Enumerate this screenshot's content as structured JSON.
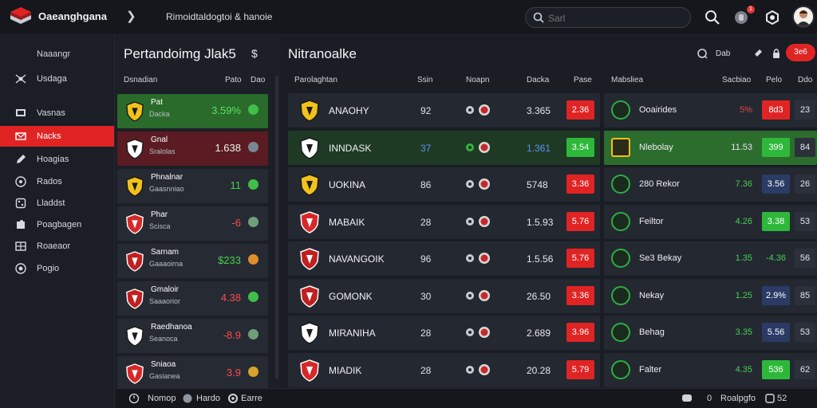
{
  "header": {
    "brand": "Oaeanghgana",
    "crumb": "Rimoidtaldogtoi & hanoie",
    "search_placeholder": "Sarl",
    "notification_count": "1",
    "icons": [
      "chevron-right-icon",
      "search-icon",
      "bell-icon",
      "settings-icon"
    ]
  },
  "sidenav": {
    "header": "Naaangr",
    "items": [
      {
        "label": "Usdaga",
        "icon": "network-icon"
      },
      {
        "label": "Vasnas",
        "icon": "flag-icon"
      },
      {
        "label": "Nacks",
        "icon": "mail-icon",
        "active": true
      },
      {
        "label": "Hoagias",
        "icon": "pen-icon"
      },
      {
        "label": "Rados",
        "icon": "target-icon"
      },
      {
        "label": "Lladdst",
        "icon": "dice-icon"
      },
      {
        "label": "Poagbagen",
        "icon": "puzzle-icon"
      },
      {
        "label": "Roaeaor",
        "icon": "table-icon"
      },
      {
        "label": "Pogio",
        "icon": "globe-icon"
      }
    ]
  },
  "midpanel": {
    "title": "Pertandoimg Jlak5",
    "dollar": "$",
    "headers": [
      "Dsnadian",
      "Pato",
      "Dao"
    ],
    "cards": [
      {
        "line1": "Pat",
        "line2": "Dacka",
        "value": "3.59%",
        "style": "green",
        "value_color": "#58e35f",
        "dot": "#3fbf4a"
      },
      {
        "line1": "Gnal",
        "line2": "Sralolas",
        "value": "1.638",
        "style": "red",
        "value_color": "#f0f0f0",
        "dot": "#7c8796"
      },
      {
        "line1": "Phnalnar",
        "line2": "Gaasnniao",
        "value": "11",
        "style": "plain",
        "value_color": "#44d14f",
        "dot": "#3fbf4a"
      },
      {
        "line1": "Phar",
        "line2": "Scisca",
        "value": "-6",
        "style": "plain",
        "value_color": "#ff4a4a",
        "dot": "#6f9e7a"
      },
      {
        "line1": "Sarnam",
        "line2": "Gaaaoirna",
        "value": "$233",
        "style": "plain",
        "value_color": "#44d14f",
        "dot": "#e08e2a"
      },
      {
        "line1": "Gmaloir",
        "line2": "Saaaorior",
        "value": "4.38",
        "style": "plain",
        "value_color": "#ff4a4a",
        "dot": "#3fbf4a"
      },
      {
        "line1": "Raedhanoa",
        "line2": "Seanoca",
        "value": "-8.9",
        "style": "plain",
        "value_color": "#ff4a4a",
        "dot": "#6f9e7a"
      },
      {
        "line1": "Sniaoa",
        "line2": "Gasianea",
        "value": "3.9",
        "style": "plain",
        "value_color": "#ff4a4a",
        "dot": "#d8a32a"
      }
    ]
  },
  "main": {
    "title": "Nitranoalke",
    "action_label": "Dab",
    "pill": "3e6",
    "left_headers": [
      "Parolaghtan",
      "Ssin",
      "Noapn",
      "Dacka",
      "Pase"
    ],
    "right_headers": [
      "Mabsliea",
      "Sacbiao",
      "Pelo",
      "Ddo"
    ],
    "rows": [
      {
        "team": "ANAOHY",
        "score": "92",
        "odds": "3.365",
        "btn": "2.36",
        "btn_color": "#e02424",
        "sel": false,
        "r_name": "Ooairides",
        "r_val": "5%",
        "r_val_color": "#e14646",
        "r_btn": "8d3",
        "r_btn_color": "#e02424",
        "r_last": "23"
      },
      {
        "team": "INNDASK",
        "score": "37",
        "odds": "1.361",
        "btn": "3.54",
        "btn_color": "#2eb83a",
        "sel": true,
        "score_color": "#5b8ef5",
        "odds_color": "#5b8ef5",
        "r_name": "Nlebolay",
        "r_val": "11.53",
        "r_val_color": "#e6e8ec",
        "r_btn": "399",
        "r_btn_color": "#2eb83a",
        "r_last": "84",
        "r_sel": true
      },
      {
        "team": "UOKINA",
        "score": "86",
        "odds": "5748",
        "btn": "3.36",
        "btn_color": "#e02424",
        "sel": false,
        "r_name": "280 Rekor",
        "r_val": "7.36",
        "r_val_color": "#44d14f",
        "r_btn": "3.56",
        "r_btn_color": "#2b3b66",
        "r_last": "26"
      },
      {
        "team": "MABAIK",
        "score": "28",
        "odds": "1.5.93",
        "btn": "5.76",
        "btn_color": "#e02424",
        "sel": false,
        "r_name": "Feiltor",
        "r_val": "4.26",
        "r_val_color": "#44d14f",
        "r_btn": "3.38",
        "r_btn_color": "#2eb83a",
        "r_last": "53"
      },
      {
        "team": "NAVANGOIK",
        "score": "96",
        "odds": "1.5.56",
        "btn": "5.76",
        "btn_color": "#e02424",
        "sel": false,
        "r_name": "Se3 Bekay",
        "r_val": "1.35",
        "r_val_color": "#44d14f",
        "r_btn": "-4.36",
        "r_btn_color": "#242831",
        "r_btn_text": "#44d14f",
        "r_last": "56"
      },
      {
        "team": "GOMONK",
        "score": "30",
        "odds": "26.50",
        "btn": "3.36",
        "btn_color": "#e02424",
        "sel": false,
        "r_name": "Nekay",
        "r_val": "1.25",
        "r_val_color": "#44d14f",
        "r_btn": "2.9%",
        "r_btn_color": "#2b3b66",
        "r_last": "85"
      },
      {
        "team": "MIRANIHA",
        "score": "28",
        "odds": "2.689",
        "btn": "3.96",
        "btn_color": "#e02424",
        "sel": false,
        "r_name": "Behag",
        "r_val": "3.35",
        "r_val_color": "#44d14f",
        "r_btn": "5.56",
        "r_btn_color": "#2b3b66",
        "r_last": "53"
      },
      {
        "team": "MIADIK",
        "score": "28",
        "odds": "20.28",
        "btn": "5.79",
        "btn_color": "#e02424",
        "sel": false,
        "r_name": "Falter",
        "r_val": "4.35",
        "r_val_color": "#44d14f",
        "r_btn": "536",
        "r_btn_color": "#2eb83a",
        "r_last": "62"
      }
    ]
  },
  "bottombar": {
    "left": [
      "Nomop",
      "Hardo",
      "Earre"
    ],
    "right_count": "0",
    "right_label": "Roalpgfo",
    "right_num": "52"
  },
  "colors": {
    "accent_red": "#e02424",
    "accent_green": "#2eb83a",
    "bg": "#1a1d24"
  }
}
